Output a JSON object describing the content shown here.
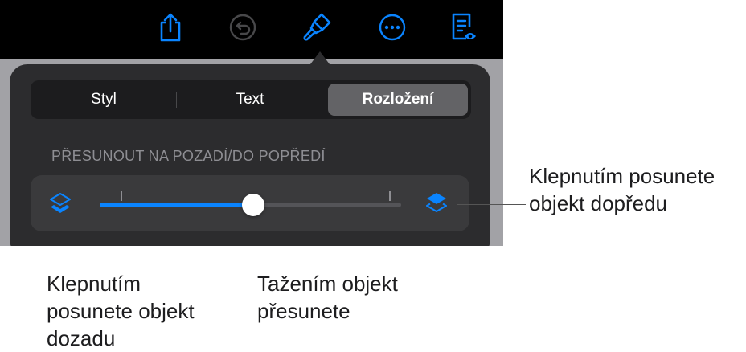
{
  "toolbar": {
    "icons": [
      "share-icon",
      "undo-icon",
      "format-brush-icon",
      "more-icon",
      "reading-view-icon"
    ],
    "accent_color": "#0a84ff",
    "disabled_color": "#48484a"
  },
  "popover": {
    "tabs": [
      {
        "label": "Styl",
        "active": false
      },
      {
        "label": "Text",
        "active": false
      },
      {
        "label": "Rozložení",
        "active": true
      }
    ],
    "section_label": "PŘESUNOUT NA POZADÍ/DO POPŘEDÍ",
    "slider": {
      "value_fraction": 0.51
    }
  },
  "callouts": {
    "right": [
      "Klepnutím posunete",
      "objekt dopředu"
    ],
    "middle": [
      "Tažením objekt",
      "přesunete"
    ],
    "left": [
      "Klepnutím",
      "posunete objekt",
      "dozadu"
    ]
  }
}
